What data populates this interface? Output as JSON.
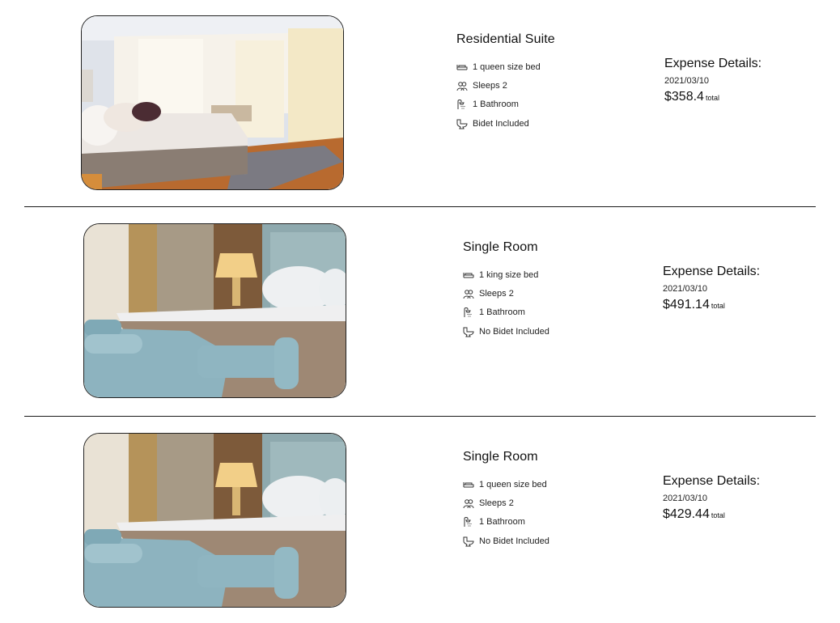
{
  "rooms": [
    {
      "title": "Residential Suite",
      "amenities": [
        {
          "icon": "bed-icon",
          "text": "1 queen size bed"
        },
        {
          "icon": "people-icon",
          "text": "Sleeps 2"
        },
        {
          "icon": "shower-icon",
          "text": "1 Bathroom"
        },
        {
          "icon": "toilet-icon",
          "text": "Bidet Included"
        }
      ],
      "expense": {
        "title": "Expense Details:",
        "date": "2021/03/10",
        "amount": "$358.4",
        "suffix": "total"
      }
    },
    {
      "title": "Single Room",
      "amenities": [
        {
          "icon": "bed-icon",
          "text": "1 king size bed"
        },
        {
          "icon": "people-icon",
          "text": "Sleeps 2"
        },
        {
          "icon": "shower-icon",
          "text": "1 Bathroom"
        },
        {
          "icon": "toilet-icon",
          "text": "No Bidet Included"
        }
      ],
      "expense": {
        "title": "Expense Details:",
        "date": "2021/03/10",
        "amount": "$491.14",
        "suffix": "total"
      }
    },
    {
      "title": "Single Room",
      "amenities": [
        {
          "icon": "bed-icon",
          "text": "1 queen size bed"
        },
        {
          "icon": "people-icon",
          "text": "Sleeps 2"
        },
        {
          "icon": "shower-icon",
          "text": "1 Bathroom"
        },
        {
          "icon": "toilet-icon",
          "text": "No Bidet Included"
        }
      ],
      "expense": {
        "title": "Expense Details:",
        "date": "2021/03/10",
        "amount": "$429.44",
        "suffix": "total"
      }
    }
  ]
}
